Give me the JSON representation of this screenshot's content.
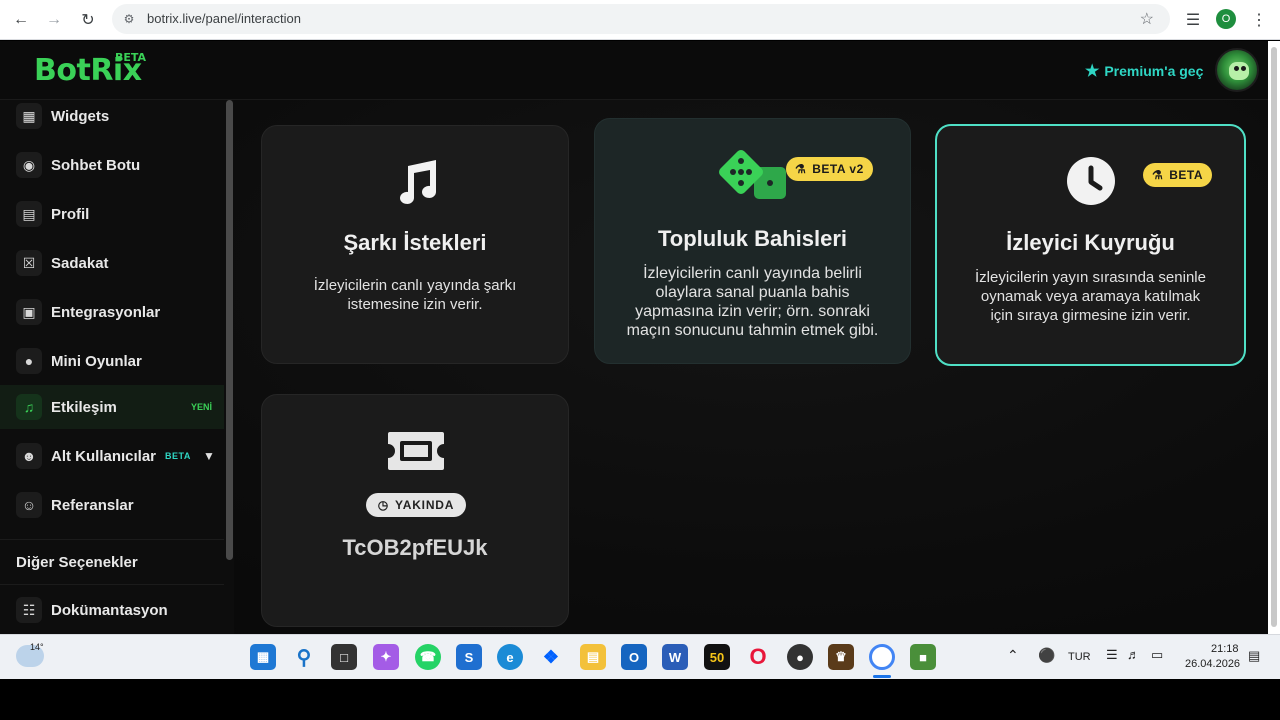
{
  "browser": {
    "url": "botrix.live/panel/interaction",
    "profile_initial": "O"
  },
  "header": {
    "logo": "BotRix",
    "logo_badge": "BETA",
    "premium_label": "Premium'a geç"
  },
  "sidebar": {
    "items": [
      {
        "label": "Widgets",
        "icon": "widgets-icon"
      },
      {
        "label": "Sohbet Botu",
        "icon": "robot-icon"
      },
      {
        "label": "Profil",
        "icon": "id-card-icon"
      },
      {
        "label": "Sadakat",
        "icon": "trophy-icon"
      },
      {
        "label": "Entegrasyonlar",
        "icon": "integration-icon"
      },
      {
        "label": "Mini Oyunlar",
        "icon": "gamepad-icon"
      },
      {
        "label": "Etkileşim",
        "icon": "music-icon",
        "badge": "YENİ"
      },
      {
        "label": "Alt Kullanıcılar",
        "icon": "users-icon",
        "badge": "BETA"
      },
      {
        "label": "Referanslar",
        "icon": "people-icon"
      }
    ],
    "section_title": "Diğer Seçenekler",
    "docs_label": "Dokümantasyon"
  },
  "cards": [
    {
      "title": "Şarkı İstekleri",
      "desc_line1": "İzleyicilerin canlı yayında şarkı",
      "desc_line2": "istemesine izin verir."
    },
    {
      "title": "Topluluk Bahisleri",
      "badge": "BETA v2",
      "desc_line1": "İzleyicilerin canlı yayında belirli",
      "desc_line2": "olaylara sanal puanla bahis",
      "desc_line3": "yapmasına izin verir; örn. sonraki",
      "desc_line4": "maçın sonucunu tahmin etmek gibi."
    },
    {
      "title": "İzleyici Kuyruğu",
      "badge": "BETA",
      "desc_line1": "İzleyicilerin yayın sırasında seninle",
      "desc_line2": "oynamak veya aramaya katılmak",
      "desc_line3": "için sıraya girmesine izin verir."
    },
    {
      "title": "TcOB2pfEUJk",
      "badge": "YAKINDA"
    }
  ],
  "taskbar": {
    "weather": "14°",
    "language": "TUR",
    "time": "21:18",
    "date": "26.04.2026"
  },
  "colors": {
    "brand_green": "#3ad157",
    "teal": "#2fd6c4",
    "beta_yellow": "#f5d547"
  }
}
